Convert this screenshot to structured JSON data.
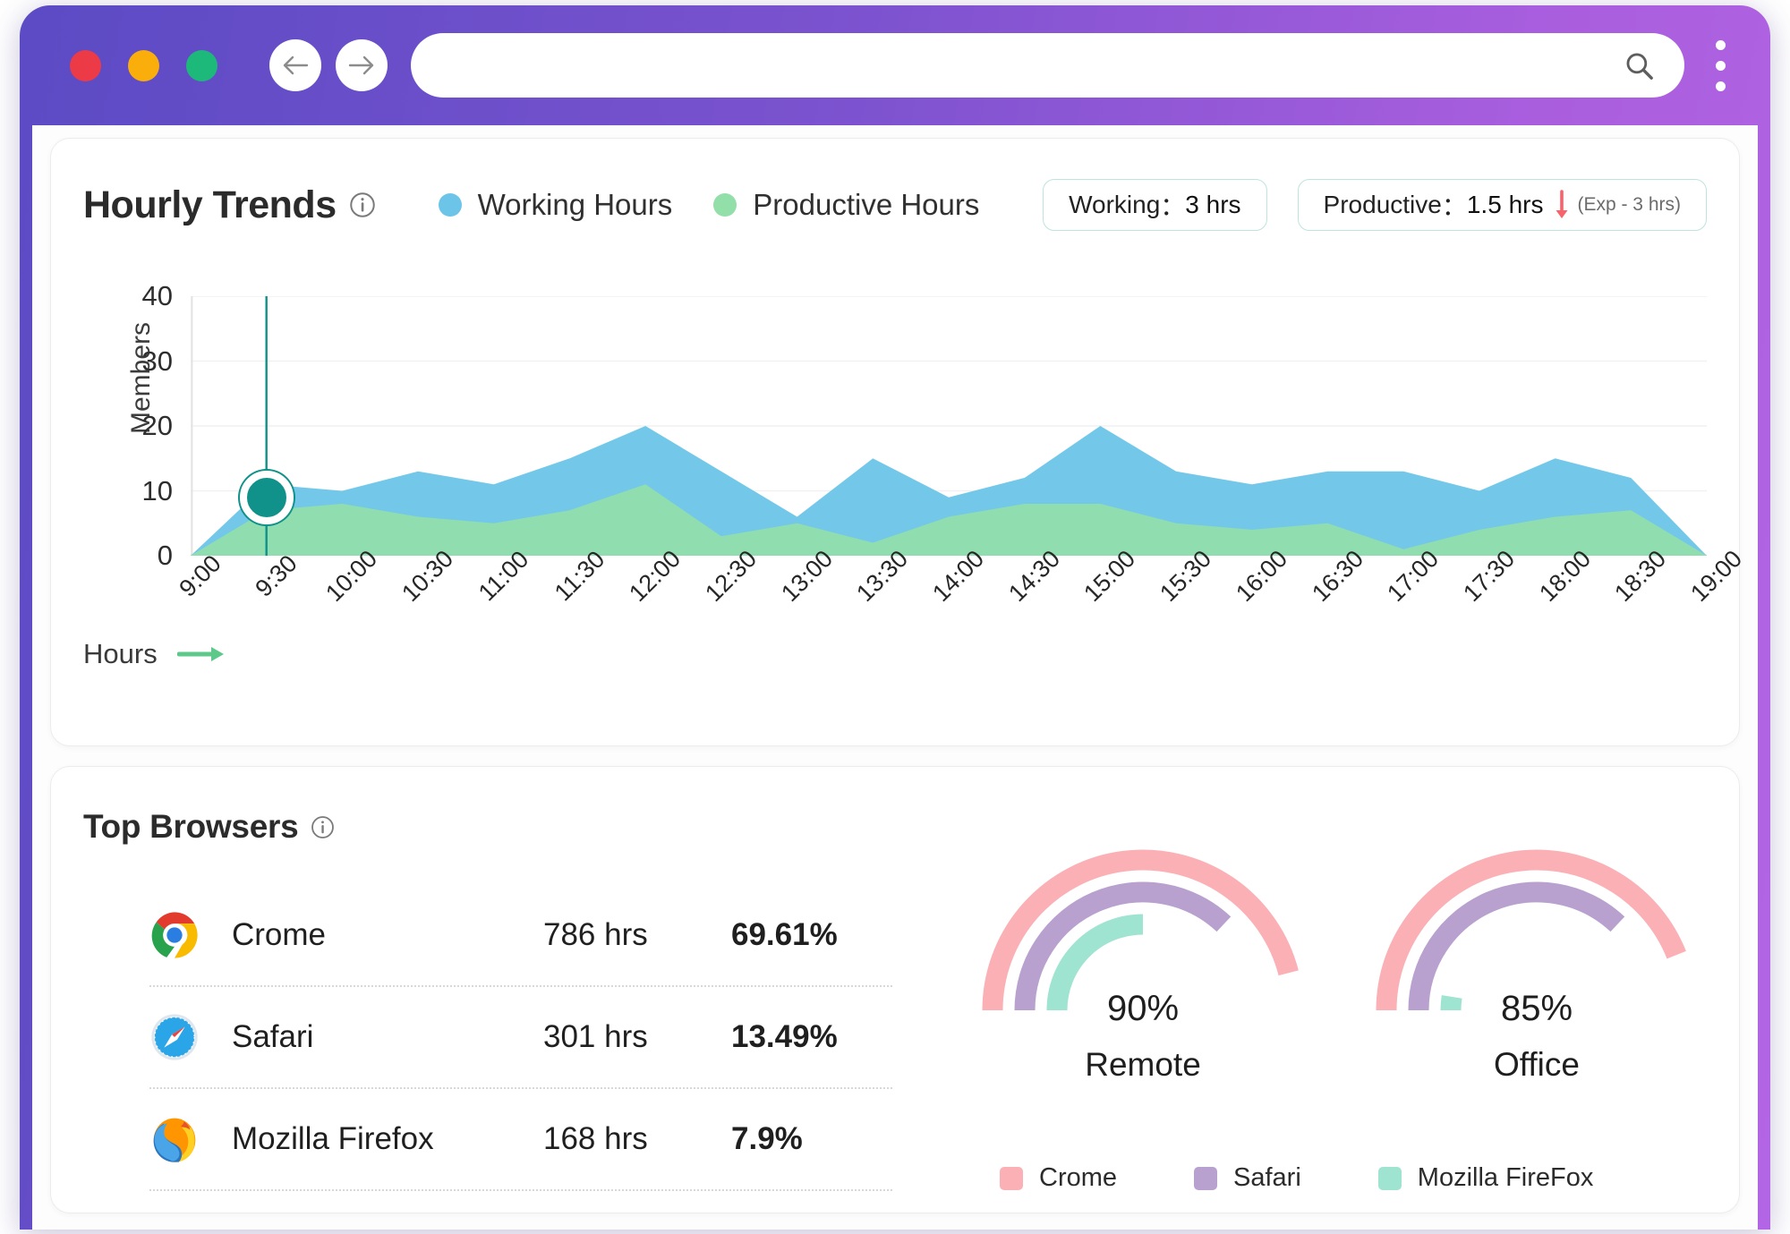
{
  "browser_chrome": {
    "traffic_lights": [
      "close",
      "minimize",
      "maximize"
    ],
    "back_icon": "arrow-left-icon",
    "forward_icon": "arrow-right-icon",
    "url_value": "",
    "url_placeholder": "",
    "search_icon": "search-icon",
    "menu_icon": "kebab-menu-icon"
  },
  "trends": {
    "title": "Hourly Trends",
    "info_icon": "info-icon",
    "legend": [
      {
        "label": "Working Hours",
        "color": "#6cc5e8"
      },
      {
        "label": "Productive Hours",
        "color": "#93dfa9"
      }
    ],
    "badges": [
      {
        "label": "Working",
        "separator": "：",
        "value": "3 hrs",
        "trend": "",
        "note": ""
      },
      {
        "label": "Productive",
        "separator": "：",
        "value": "1.5 hrs",
        "trend": "down-arrow-icon",
        "note": "(Exp - 3 hrs)"
      }
    ],
    "x_axis_caption": "Hours",
    "x_axis_arrow": "arrow-right-icon",
    "marker": {
      "x_label": "9:30",
      "value": 9
    }
  },
  "chart_data": {
    "type": "area",
    "title": "Hourly Trends",
    "xlabel": "Hours",
    "ylabel": "Members",
    "ylim": [
      0,
      40
    ],
    "yticks": [
      0,
      10,
      20,
      30,
      40
    ],
    "grid": true,
    "legend_position": "top",
    "stacked": false,
    "categories": [
      "9:00",
      "9:30",
      "10:00",
      "10:30",
      "11:00",
      "11:30",
      "12:00",
      "12:30",
      "13:00",
      "13:30",
      "14:00",
      "14:30",
      "15:00",
      "15:30",
      "16:00",
      "16:30",
      "17:00",
      "17:30",
      "18:00",
      "18:30",
      "19:00"
    ],
    "series": [
      {
        "name": "Working Hours",
        "color": "#6cc5e8",
        "values": [
          0,
          11,
          10,
          13,
          11,
          15,
          20,
          13,
          6,
          15,
          9,
          12,
          20,
          13,
          11,
          13,
          13,
          10,
          15,
          12,
          0
        ]
      },
      {
        "name": "Productive Hours",
        "color": "#93dfa9",
        "values": [
          0,
          7,
          8,
          6,
          5,
          7,
          11,
          3,
          5,
          2,
          6,
          8,
          8,
          5,
          4,
          5,
          1,
          4,
          6,
          7,
          0
        ]
      }
    ],
    "annotations": [
      {
        "type": "vertical-marker",
        "x": "9:30",
        "y": 9,
        "color": "#10918a"
      }
    ]
  },
  "browsers": {
    "title": "Top Browsers",
    "info_icon": "info-icon",
    "rows": [
      {
        "icon": "chrome-icon",
        "name": "Crome",
        "hours": "786 hrs",
        "percent": "69.61%"
      },
      {
        "icon": "safari-icon",
        "name": "Safari",
        "hours": "301 hrs",
        "percent": "13.49%"
      },
      {
        "icon": "firefox-icon",
        "name": "Mozilla Firefox",
        "hours": "168 hrs",
        "percent": "7.9%"
      }
    ],
    "gauges": [
      {
        "percent": "90%",
        "label": "Remote",
        "arcs": [
          {
            "name": "Crome",
            "color": "#fbb0b5",
            "fraction": 0.92
          },
          {
            "name": "Safari",
            "color": "#b8a1ce",
            "fraction": 0.74
          },
          {
            "name": "Mozilla FireFox",
            "color": "#9fe3d1",
            "fraction": 0.5
          }
        ]
      },
      {
        "percent": "85%",
        "label": "Office",
        "arcs": [
          {
            "name": "Crome",
            "color": "#fbb0b5",
            "fraction": 0.88
          },
          {
            "name": "Safari",
            "color": "#b8a1ce",
            "fraction": 0.74
          },
          {
            "name": "Mozilla FireFox",
            "color": "#9fe3d1",
            "fraction": 0.05
          }
        ]
      }
    ],
    "legend": [
      {
        "label": "Crome",
        "color": "#fbb0b5"
      },
      {
        "label": "Safari",
        "color": "#b8a1ce"
      },
      {
        "label": "Mozilla FireFox",
        "color": "#9fe3d1"
      }
    ]
  }
}
